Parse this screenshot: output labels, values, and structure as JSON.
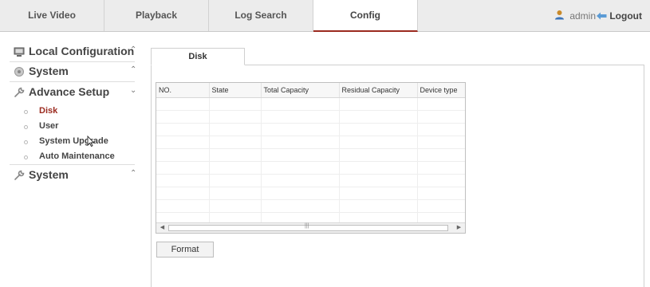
{
  "topnav": {
    "tabs": [
      {
        "label": "Live Video"
      },
      {
        "label": "Playback"
      },
      {
        "label": "Log Search"
      },
      {
        "label": "Config",
        "active": true
      }
    ],
    "user": {
      "name": "admin",
      "icon": "user-icon"
    },
    "logout": {
      "label": "Logout",
      "icon": "logout-icon"
    }
  },
  "sidebar": {
    "sections": [
      {
        "label": "Local Configuration",
        "icon": "computer-icon",
        "state": "collapsed"
      },
      {
        "label": "System",
        "icon": "system-icon",
        "state": "collapsed"
      },
      {
        "label": "Advance Setup",
        "icon": "wrench-icon",
        "state": "expanded"
      },
      {
        "label": "System",
        "icon": "wrench-icon",
        "state": "collapsed"
      }
    ],
    "items": [
      {
        "label": "Disk",
        "active": true
      },
      {
        "label": "User"
      },
      {
        "label": "System Upgrade"
      },
      {
        "label": "Auto Maintenance"
      }
    ]
  },
  "content": {
    "tab": {
      "label": "Disk"
    },
    "table": {
      "columns": [
        "NO.",
        "State",
        "Total Capacity",
        "Residual Capacity",
        "Device type"
      ],
      "rows": []
    },
    "format_button": "Format"
  },
  "colors": {
    "accent": "#9b2a1f",
    "nav_background": "#ececec"
  }
}
